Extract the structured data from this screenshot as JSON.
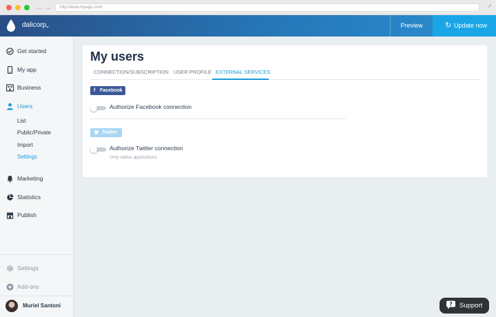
{
  "browser": {
    "url": "http://www.myapp.com/"
  },
  "header": {
    "org_name": "dalicorp",
    "preview_label": "Preview",
    "update_label": "Update now"
  },
  "sidebar": {
    "items": [
      {
        "label": "Get started",
        "icon": "check-circle-icon"
      },
      {
        "label": "My app",
        "icon": "smartphone-icon"
      },
      {
        "label": "Business",
        "icon": "building-icon"
      },
      {
        "label": "Users",
        "icon": "user-icon"
      },
      {
        "label": "Marketing",
        "icon": "bell-icon"
      },
      {
        "label": "Statistics",
        "icon": "pie-chart-icon"
      },
      {
        "label": "Publish",
        "icon": "store-icon"
      }
    ],
    "users_subitems": [
      {
        "label": "List"
      },
      {
        "label": "Public/Private"
      },
      {
        "label": "Import"
      },
      {
        "label": "Settings",
        "active": true
      }
    ],
    "bottom_items": [
      {
        "label": "Settings",
        "icon": "gear-icon"
      },
      {
        "label": "Add-ons",
        "icon": "plus-circle-icon"
      }
    ],
    "user_name": "Muriel Santoni"
  },
  "main": {
    "title": "My users",
    "tabs": [
      {
        "label": "CONNECTION/SUBSCRIPTION"
      },
      {
        "label": "USER PROFILE"
      },
      {
        "label": "EXTERNAL SERVICES",
        "active": true
      }
    ],
    "services": [
      {
        "badge": "Facebook",
        "option_label": "Authorize Facebook connection",
        "enabled": false
      },
      {
        "badge": "Twitter",
        "option_label": "Authorize Twitter connection",
        "hint": "Only native applications",
        "enabled": false
      }
    ]
  },
  "support_label": "Support",
  "colors": {
    "accent": "#1a9ad6",
    "facebook": "#3b5998",
    "twitter": "#a9d6f2",
    "header_start": "#2a4f86",
    "update_button": "#1aa6e6"
  }
}
